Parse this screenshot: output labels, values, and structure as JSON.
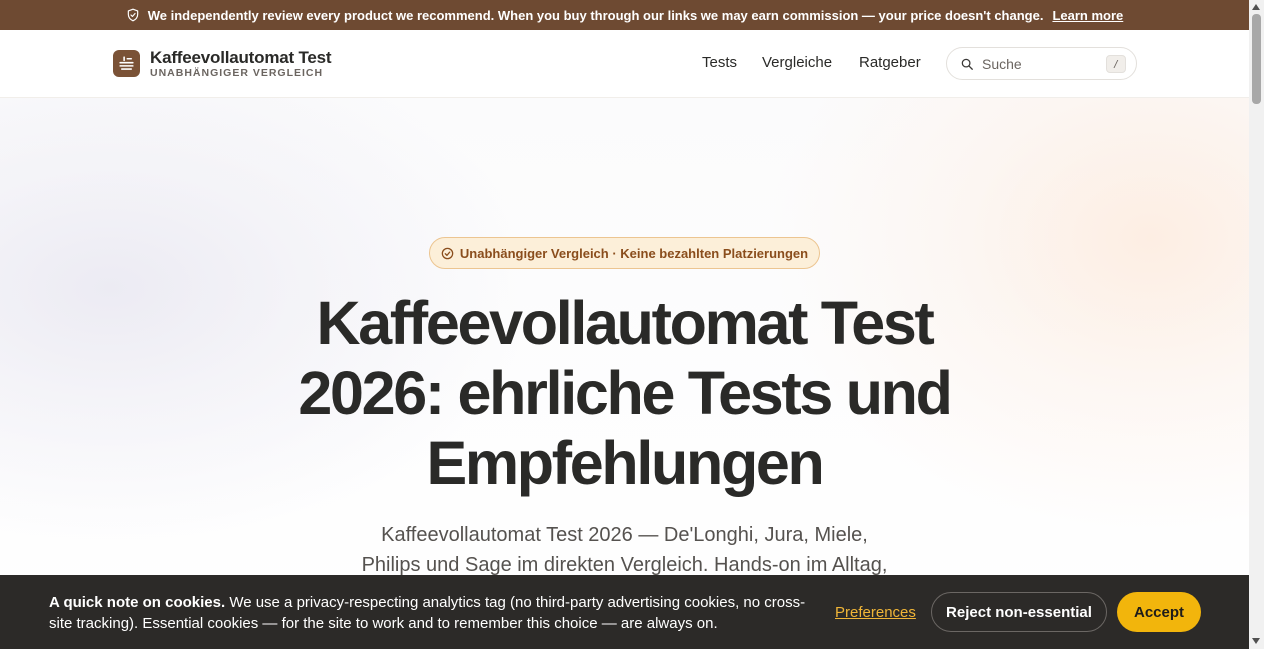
{
  "topbar": {
    "message": "We independently review every product we recommend. When you buy through our links we may earn commission — your price doesn't change.",
    "link_label": "Learn more",
    "background": "#6e4a32",
    "icon": "shield-check-icon"
  },
  "header": {
    "brand_title": "Kaffeevollautomat Test",
    "brand_subtitle": "UNABHÄNGIGER VERGLEICH",
    "logo_icon": "coffee-machine-icon",
    "nav": [
      "Tests",
      "Vergleiche",
      "Ratgeber"
    ],
    "search": {
      "placeholder": "Suche",
      "shortcut": "/",
      "icon": "search-icon"
    }
  },
  "hero": {
    "badge": "Unabhängiger Vergleich · Keine bezahlten Platzierungen",
    "badge_icon": "check-circle-icon",
    "title_lines": [
      "Kaffeevollautomat Test",
      "2026: ehrliche Tests und",
      "Empfehlungen"
    ],
    "lede_lines": [
      "Kaffeevollautomat Test 2026 — De'Longhi, Jura, Miele,",
      "Philips und Sage im direkten Vergleich. Hands-on im Alltag,"
    ]
  },
  "cookie": {
    "title": "A quick note on cookies.",
    "body": "We use a privacy-respecting analytics tag (no third-party advertising cookies, no cross-site tracking). Essential cookies — for the site to work and to remember this choice — are always on.",
    "preferences_label": "Preferences",
    "reject_label": "Reject non-essential",
    "accept_label": "Accept",
    "accent": "#f2b50c"
  }
}
